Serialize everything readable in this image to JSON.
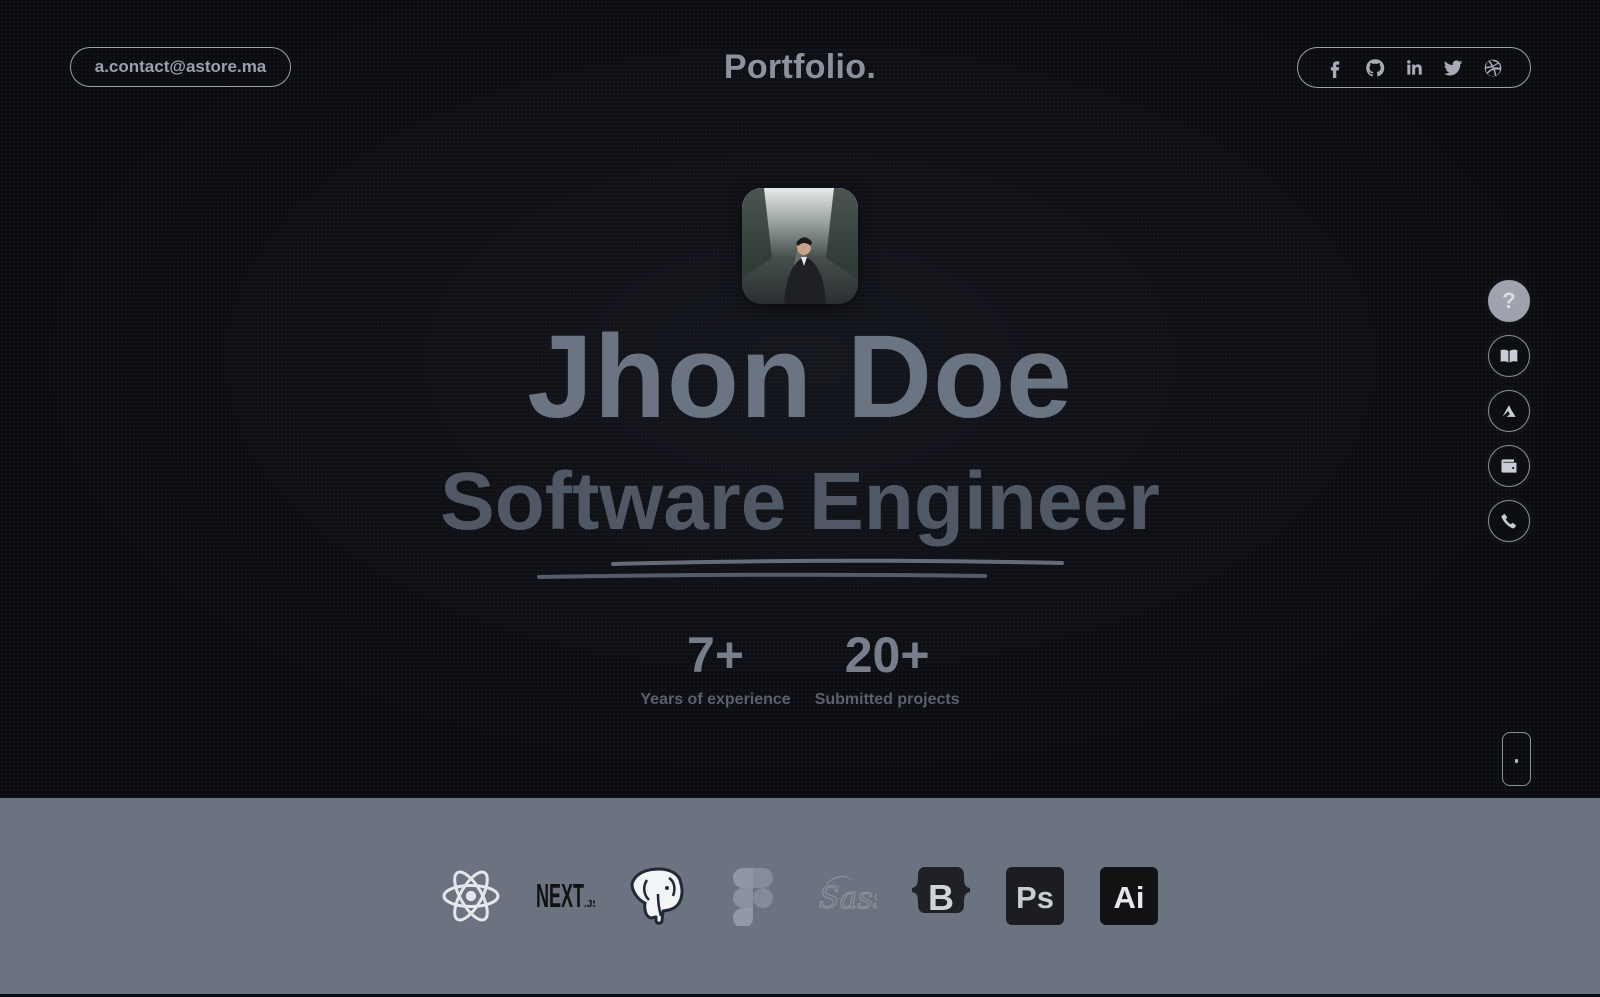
{
  "header": {
    "email": "a.contact@astore.ma",
    "logo": "Portfolio.",
    "social_icons": [
      "facebook-icon",
      "github-icon",
      "linkedin-icon",
      "twitter-icon",
      "dribbble-icon"
    ]
  },
  "hero": {
    "name": "Jhon Doe",
    "role": "Software Engineer",
    "stats": [
      {
        "value": "7+",
        "label": "Years of experience"
      },
      {
        "value": "20+",
        "label": "Submitted projects"
      }
    ]
  },
  "side_nav": {
    "items": [
      "question-icon",
      "book-icon",
      "send-icon",
      "wallet-icon",
      "phone-icon"
    ],
    "active_symbol": "?"
  },
  "tech_stack": {
    "items": [
      "react-icon",
      "nextjs-icon",
      "postgresql-icon",
      "figma-icon",
      "sass-icon",
      "bootstrap-icon",
      "photoshop-icon",
      "illustrator-icon"
    ],
    "labels": {
      "nextjs": "NEXT",
      "nextjs_sub": ".JS",
      "sass": "Sass",
      "bootstrap": "B",
      "photoshop": "Ps",
      "illustrator": "Ai"
    }
  },
  "colors": {
    "background": "#0b0c10",
    "accent": "#6b7280",
    "text_muted": "#9aa1ad"
  }
}
